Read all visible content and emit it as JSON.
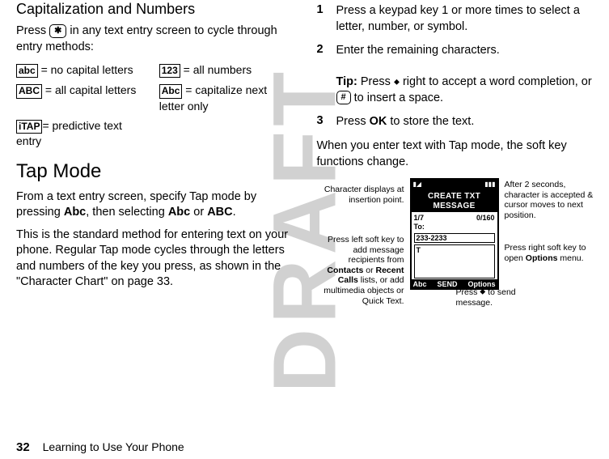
{
  "watermark": "DRAFT",
  "left": {
    "head1": "Capitalization and Numbers",
    "p1a": "Press ",
    "p1_key": "✱",
    "p1b": " in any text entry screen to cycle through entry methods:",
    "opts": {
      "abc_l": "abc",
      "abc_t": " = no capital letters",
      "n123_l": "123",
      "n123_t": " = all numbers",
      "ABC_l": "ABC",
      "ABC_t": " = all capital letters",
      "Abc_l": "Abc",
      "Abc_t": " = capitalize next letter only",
      "itap_l": "iTAP",
      "itap_t": "= predictive text entry"
    },
    "head2": "Tap Mode",
    "p2a": "From a text entry screen, specify Tap mode by pressing ",
    "p2_b1": "Abc",
    "p2b": ", then selecting ",
    "p2_b2": "Abc",
    "p2c": " or ",
    "p2_b3": "ABC",
    "p2d": ".",
    "p3": "This is the standard method for entering text on your phone. Regular Tap mode cycles through the letters and numbers of the key you press, as shown in the \"Character Chart\" on page 33."
  },
  "right": {
    "steps": [
      {
        "n": "1",
        "t": "Press a keypad key 1 or more times to select a letter, number, or symbol."
      },
      {
        "n": "2",
        "t": "Enter the remaining characters."
      },
      {
        "n": "3",
        "t_a": "Press ",
        "t_key": "OK",
        "t_b": " to store the text."
      }
    ],
    "tip_a": "Tip: ",
    "tip_b": "Press ",
    "tip_c": " right to accept a word completion, or ",
    "tip_key": "#",
    "tip_d": " to insert a space.",
    "p_after": "When you enter text with Tap mode, the soft key functions change."
  },
  "phone": {
    "title": "CREATE TXT MESSAGE",
    "counter_left": "1/7",
    "counter_right": "0/160",
    "to_label": "To:",
    "to_value": "233-2233",
    "soft_left": "Abc",
    "soft_mid": "SEND",
    "soft_right": "Options"
  },
  "callouts": {
    "c1": "Character displays at insertion point.",
    "c2": "Press left soft key to add message recipients from Contacts or Recent Calls lists, or add multimedia objects or Quick Text.",
    "c3": "After 2 seconds, character is accepted & cursor moves to next position.",
    "c4": "Press right soft key to open Options menu.",
    "c5_a": "Press ",
    "c5_b": " to send message.",
    "c2_b1": "Contacts",
    "c2_b2": "Recent Calls",
    "c4_b1": "Options"
  },
  "footer": {
    "page": "32",
    "chapter": "Learning to Use Your Phone"
  }
}
